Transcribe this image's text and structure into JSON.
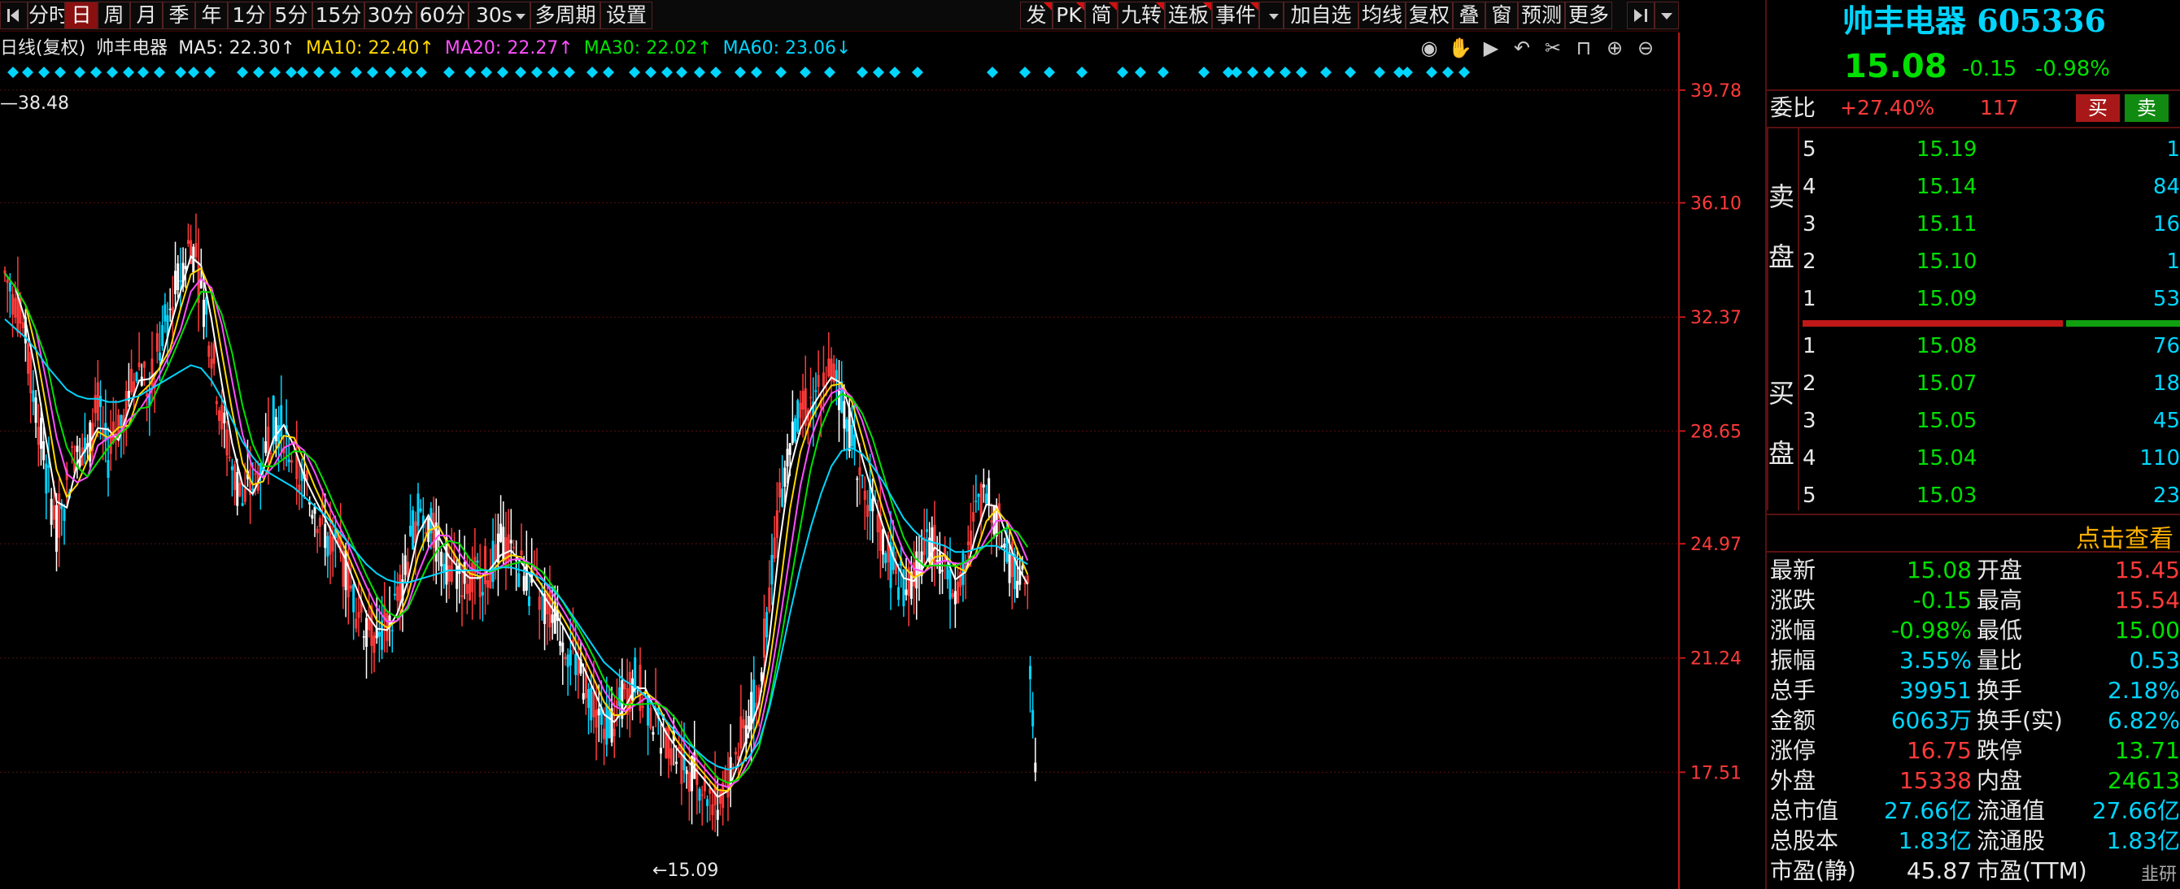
{
  "toolbar": {
    "left_tabs": [
      "分时",
      "日",
      "周",
      "月",
      "季",
      "年",
      "1分",
      "5分",
      "15分",
      "30分",
      "60分",
      "30s",
      "多周期",
      "设置"
    ],
    "active_tab": "日",
    "right_buttons": [
      "发",
      "PK",
      "简",
      "九转",
      "连板",
      "事件",
      "加自选",
      "均线",
      "复权",
      "叠",
      "窗",
      "预测",
      "更多"
    ]
  },
  "legend": {
    "title": "日线(复权)",
    "stock": "帅丰电器",
    "ma5": "MA5: 22.30↑",
    "ma10": "MA10: 22.40↑",
    "ma20": "MA20: 22.27↑",
    "ma30": "MA30: 22.02↑",
    "ma60": "MA60: 23.06↓"
  },
  "chart_data": {
    "type": "line",
    "y_ticks": [
      "39.78",
      "36.10",
      "32.37",
      "28.65",
      "24.97",
      "21.24",
      "17.51"
    ],
    "y_tick_values": [
      39.78,
      36.1,
      32.37,
      28.65,
      24.97,
      21.24,
      17.51
    ],
    "ylim": [
      14.6,
      40.6
    ],
    "high_label": "38.48",
    "low_label": "15.09",
    "low_marker_text": "←15.09",
    "series": [
      {
        "name": "MA5",
        "color": "#ffffff"
      },
      {
        "name": "MA10",
        "color": "#ffd800"
      },
      {
        "name": "MA20",
        "color": "#ff50ff"
      },
      {
        "name": "MA30",
        "color": "#00e000"
      },
      {
        "name": "MA60",
        "color": "#00d5ff"
      }
    ],
    "close": [
      33.8,
      32.9,
      31.6,
      29.5,
      27.2,
      25.5,
      26.8,
      28.4,
      27.9,
      29.6,
      27.8,
      28.9,
      29.8,
      30.8,
      29.9,
      31.5,
      32.6,
      33.8,
      34.9,
      33.2,
      31.4,
      29.0,
      27.5,
      26.3,
      26.9,
      27.8,
      29.0,
      28.7,
      27.6,
      26.7,
      26.2,
      25.4,
      24.8,
      24.1,
      23.0,
      22.4,
      22.0,
      22.3,
      23.1,
      24.4,
      26.2,
      25.6,
      24.8,
      24.3,
      24.0,
      23.7,
      24.0,
      24.3,
      24.9,
      24.6,
      24.1,
      23.6,
      23.1,
      22.6,
      22.0,
      21.3,
      20.6,
      19.8,
      19.0,
      19.3,
      19.9,
      20.6,
      19.9,
      19.1,
      18.5,
      18.1,
      17.7,
      17.4,
      16.9,
      16.5,
      17.3,
      18.3,
      19.3,
      20.2,
      23.5,
      26.5,
      28.3,
      29.1,
      29.6,
      30.2,
      30.6,
      29.8,
      28.4,
      27.1,
      26.1,
      25.0,
      24.1,
      23.6,
      23.9,
      24.6,
      25.1,
      24.1,
      23.5,
      24.6,
      25.9,
      26.6,
      25.8,
      24.6,
      23.9,
      23.4,
      15.08
    ],
    "ma60": [
      32.3,
      32.0,
      31.7,
      31.3,
      30.8,
      30.4,
      30.0,
      29.8,
      29.7,
      29.7,
      29.6,
      29.6,
      29.7,
      29.8,
      30.0,
      30.2,
      30.4,
      30.6,
      30.8,
      30.7,
      30.3,
      29.7,
      29.0,
      28.3,
      27.8,
      27.4,
      27.2,
      27.0,
      26.8,
      26.5,
      26.2,
      25.9,
      25.5,
      25.1,
      24.7,
      24.3,
      24.0,
      23.8,
      23.7,
      23.7,
      23.8,
      23.9,
      24.0,
      24.1,
      24.1,
      24.1,
      24.1,
      24.1,
      24.2,
      24.2,
      24.1,
      24.0,
      23.8,
      23.5,
      23.1,
      22.6,
      22.1,
      21.6,
      21.1,
      20.8,
      20.5,
      20.3,
      20.0,
      19.6,
      19.2,
      18.8,
      18.5,
      18.2,
      17.9,
      17.7,
      17.6,
      17.7,
      18.0,
      18.5,
      19.6,
      21.1,
      22.7,
      24.2,
      25.5,
      26.6,
      27.5,
      28.0,
      28.1,
      27.9,
      27.5,
      27.0,
      26.4,
      25.8,
      25.4,
      25.1,
      25.0,
      24.9,
      24.7,
      24.7,
      24.8,
      24.9,
      24.9,
      24.7,
      24.5,
      24.3,
      23.06
    ]
  },
  "right_panel": {
    "stock_name": "帅丰电器",
    "stock_code": "605336",
    "price": "15.08",
    "change": "-0.15",
    "change_pct": "-0.98%",
    "webi_label": "委比",
    "webi_pct": "+27.40%",
    "webi_diff": "117",
    "buy_btn": "买",
    "sell_btn": "卖",
    "sell_side_label": [
      "卖",
      "盘"
    ],
    "buy_side_label": [
      "买",
      "盘"
    ],
    "asks": [
      {
        "level": "5",
        "price": "15.19",
        "vol": "1"
      },
      {
        "level": "4",
        "price": "15.14",
        "vol": "84"
      },
      {
        "level": "3",
        "price": "15.11",
        "vol": "16"
      },
      {
        "level": "2",
        "price": "15.10",
        "vol": "1"
      },
      {
        "level": "1",
        "price": "15.09",
        "vol": "53"
      }
    ],
    "bids": [
      {
        "level": "1",
        "price": "15.08",
        "vol": "76"
      },
      {
        "level": "2",
        "price": "15.07",
        "vol": "18"
      },
      {
        "level": "3",
        "price": "15.05",
        "vol": "45"
      },
      {
        "level": "4",
        "price": "15.04",
        "vol": "110"
      },
      {
        "level": "5",
        "price": "15.03",
        "vol": "23"
      }
    ],
    "click_view": "点击查看",
    "quote_rows": [
      {
        "l1": "最新",
        "v1": "15.08",
        "c1": "green",
        "l2": "开盘",
        "v2": "15.45",
        "c2": "red"
      },
      {
        "l1": "涨跌",
        "v1": "-0.15",
        "c1": "green",
        "l2": "最高",
        "v2": "15.54",
        "c2": "red"
      },
      {
        "l1": "涨幅",
        "v1": "-0.98%",
        "c1": "green",
        "l2": "最低",
        "v2": "15.00",
        "c2": "green"
      },
      {
        "l1": "振幅",
        "v1": "3.55%",
        "c1": "cyan",
        "l2": "量比",
        "v2": "0.53",
        "c2": "cyan"
      },
      {
        "l1": "总手",
        "v1": "39951",
        "c1": "cyan",
        "l2": "换手",
        "v2": "2.18%",
        "c2": "cyan"
      },
      {
        "l1": "金额",
        "v1": "6063万",
        "c1": "cyan",
        "l2": "换手(实)",
        "v2": "6.82%",
        "c2": "cyan"
      },
      {
        "l1": "涨停",
        "v1": "16.75",
        "c1": "red",
        "l2": "跌停",
        "v2": "13.71",
        "c2": "green"
      },
      {
        "l1": "外盘",
        "v1": "15338",
        "c1": "red",
        "l2": "内盘",
        "v2": "24613",
        "c2": "green"
      },
      {
        "l1": "总市值",
        "v1": "27.66亿",
        "c1": "cyan",
        "l2": "流通值",
        "v2": "27.66亿",
        "c2": "cyan"
      },
      {
        "l1": "总股本",
        "v1": "1.83亿",
        "c1": "cyan",
        "l2": "流通股",
        "v2": "1.83亿",
        "c2": "cyan"
      },
      {
        "l1": "市盈(静)",
        "v1": "45.87",
        "c1": "white",
        "l2": "市盈(TTM)",
        "v2": "",
        "c2": "white"
      }
    ],
    "watermark": "韭研"
  },
  "colors": {
    "up": "#ff3a3a",
    "down": "#00e000",
    "cyan": "#00d5ff",
    "grid": "#5a1010",
    "axis": "#c01818"
  }
}
